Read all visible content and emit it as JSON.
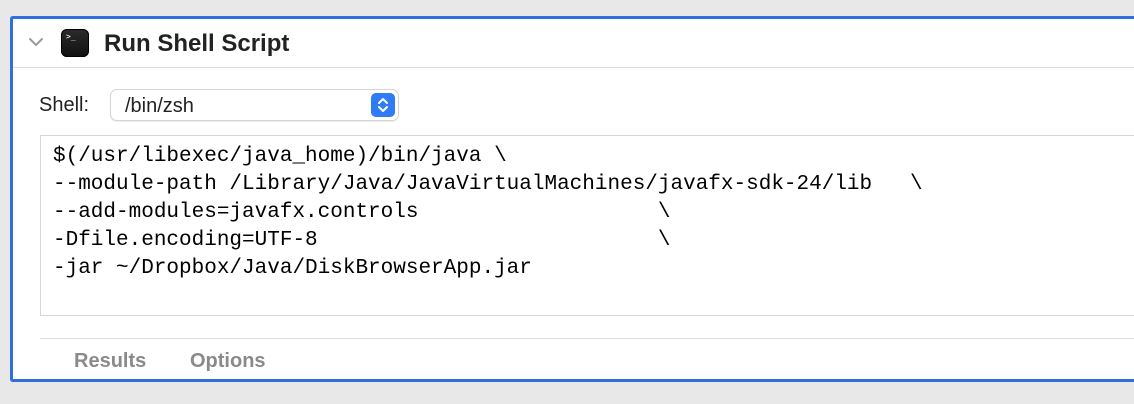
{
  "action": {
    "title": "Run Shell Script",
    "icon": "terminal-icon",
    "icon_prompt": ">_"
  },
  "shell": {
    "label": "Shell:",
    "selected": "/bin/zsh"
  },
  "script": {
    "lines": [
      "$(/usr/libexec/java_home)/bin/java \\",
      "--module-path /Library/Java/JavaVirtualMachines/javafx-sdk-24/lib   \\",
      "--add-modules=javafx.controls                   \\",
      "-Dfile.encoding=UTF-8                           \\",
      "-jar ~/Dropbox/Java/DiskBrowserApp.jar"
    ]
  },
  "tabs": {
    "results": "Results",
    "options": "Options"
  },
  "colors": {
    "selection_border": "#2f6fe0",
    "popup_accent": "#2f7cf6",
    "background": "#e8e8e8"
  }
}
